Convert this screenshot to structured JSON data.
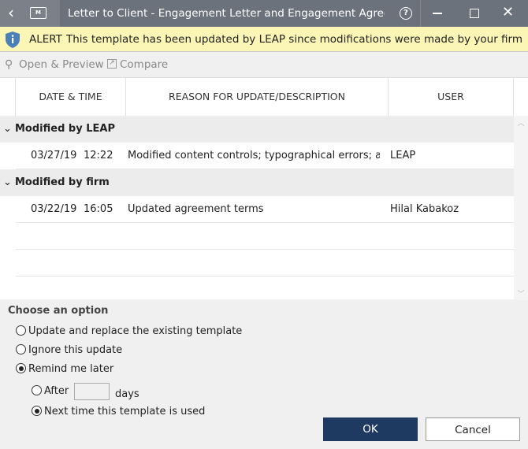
{
  "window": {
    "title": "Letter to Client - Engagement Letter and Engagement Agreement",
    "back": "‹",
    "folder_badge": "M"
  },
  "alert": {
    "label": "ALERT",
    "message": "This template has been updated by LEAP since modifications were made by your firm"
  },
  "toolbar": {
    "open_preview": "Open & Preview",
    "compare": "Compare"
  },
  "table": {
    "headers": [
      "DATE & TIME",
      "REASON FOR UPDATE/DESCRIPTION",
      "USER"
    ],
    "groups": [
      {
        "label": "Modified by LEAP",
        "rows": [
          {
            "date": "03/27/19",
            "time": "12:22",
            "reason": "Modified content controls; typographical errors; an...",
            "user": "LEAP"
          }
        ]
      },
      {
        "label": "Modified by firm",
        "rows": [
          {
            "date": "03/22/19",
            "time": "16:05",
            "reason": "Updated agreement terms",
            "user": "Hilal Kabakoz"
          }
        ]
      }
    ]
  },
  "options": {
    "heading": "Choose an option",
    "update": "Update and replace the existing template",
    "ignore": "Ignore this update",
    "remind": "Remind me later",
    "after": "After",
    "after_value": "",
    "days": "days",
    "next_time": "Next time this template is used"
  },
  "buttons": {
    "ok": "OK",
    "cancel": "Cancel"
  }
}
